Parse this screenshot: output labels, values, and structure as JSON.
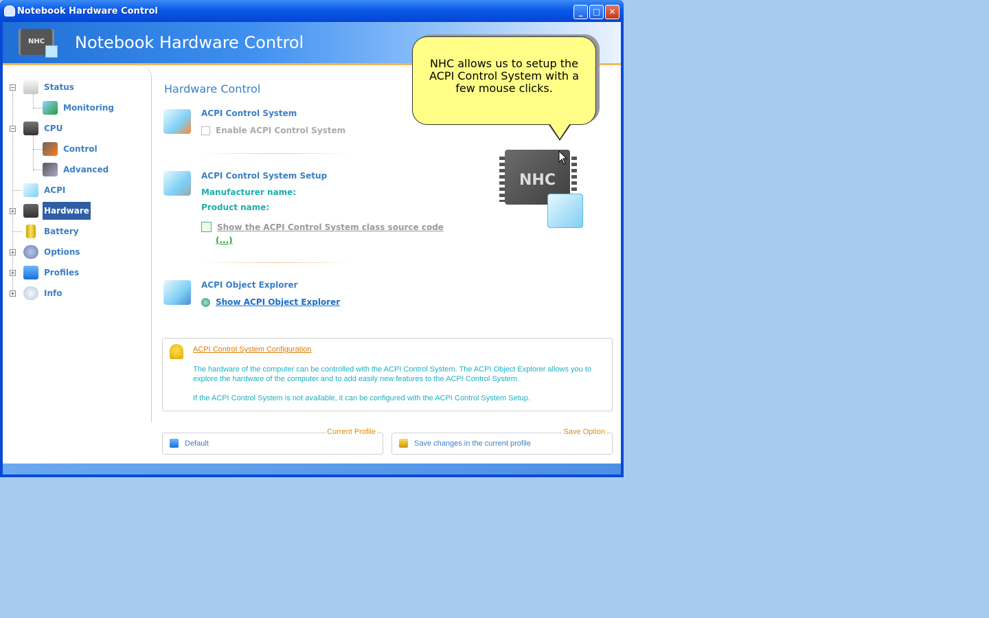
{
  "window": {
    "title": "Notebook Hardware Control",
    "buttons": {
      "minimize": "_",
      "maximize": "□",
      "close": "✕"
    }
  },
  "banner": {
    "logo_text": "NHC",
    "title": "Notebook Hardware Control"
  },
  "sidebar": {
    "items": [
      {
        "label": "Status",
        "icon": "laptop-icon"
      },
      {
        "label": "Monitoring",
        "icon": "chart-icon"
      },
      {
        "label": "CPU",
        "icon": "cpu-icon"
      },
      {
        "label": "Control",
        "icon": "control-icon"
      },
      {
        "label": "Advanced",
        "icon": "advanced-icon"
      },
      {
        "label": "ACPI",
        "icon": "ice-cube-icon"
      },
      {
        "label": "Hardware",
        "icon": "hardware-icon",
        "selected": true
      },
      {
        "label": "Battery",
        "icon": "battery-icon"
      },
      {
        "label": "Options",
        "icon": "gears-icon"
      },
      {
        "label": "Profiles",
        "icon": "profiles-icon"
      },
      {
        "label": "Info",
        "icon": "info-icon"
      }
    ]
  },
  "main": {
    "title": "Hardware Control",
    "acpi_control": {
      "heading": "ACPI Control System",
      "checkbox_label": "Enable ACPI Control System",
      "checked": false
    },
    "acpi_setup": {
      "heading": "ACPI Control System Setup",
      "manufacturer_label": "Manufacturer name:",
      "product_label": "Product name:",
      "source_link": "Show the ACPI Control System class source code",
      "more_link": "(...)"
    },
    "acpi_explorer": {
      "heading": "ACPI Object Explorer",
      "link": "Show ACPI Object Explorer"
    },
    "info": {
      "title": "ACPI Control System Configuration",
      "text1": "The hardware of the computer can be controlled with the ACPI Control System. The ACPI Object Explorer allows you to explore the hardware of the computer and to add easily new features to the ACPI Control System.",
      "text2": "If the ACPI Control System is not available, it can be configured with the ACPI Control System Setup."
    },
    "nhc_logo_text": "NHC"
  },
  "bottom": {
    "current_profile": {
      "legend": "Current Profile",
      "value": "Default"
    },
    "save_option": {
      "legend": "Save Option",
      "value": "Save changes in the current profile"
    }
  },
  "callout": {
    "text": "NHC allows us to setup the ACPI Control System with a few mouse clicks."
  },
  "colors": {
    "desktop": "#a6caf0",
    "accent_blue": "#3a7fc4",
    "selected_bg": "#2e5fa6",
    "teal_text": "#1bb0a8",
    "orange_text": "#e08a00",
    "callout_bg": "#ffff88"
  }
}
